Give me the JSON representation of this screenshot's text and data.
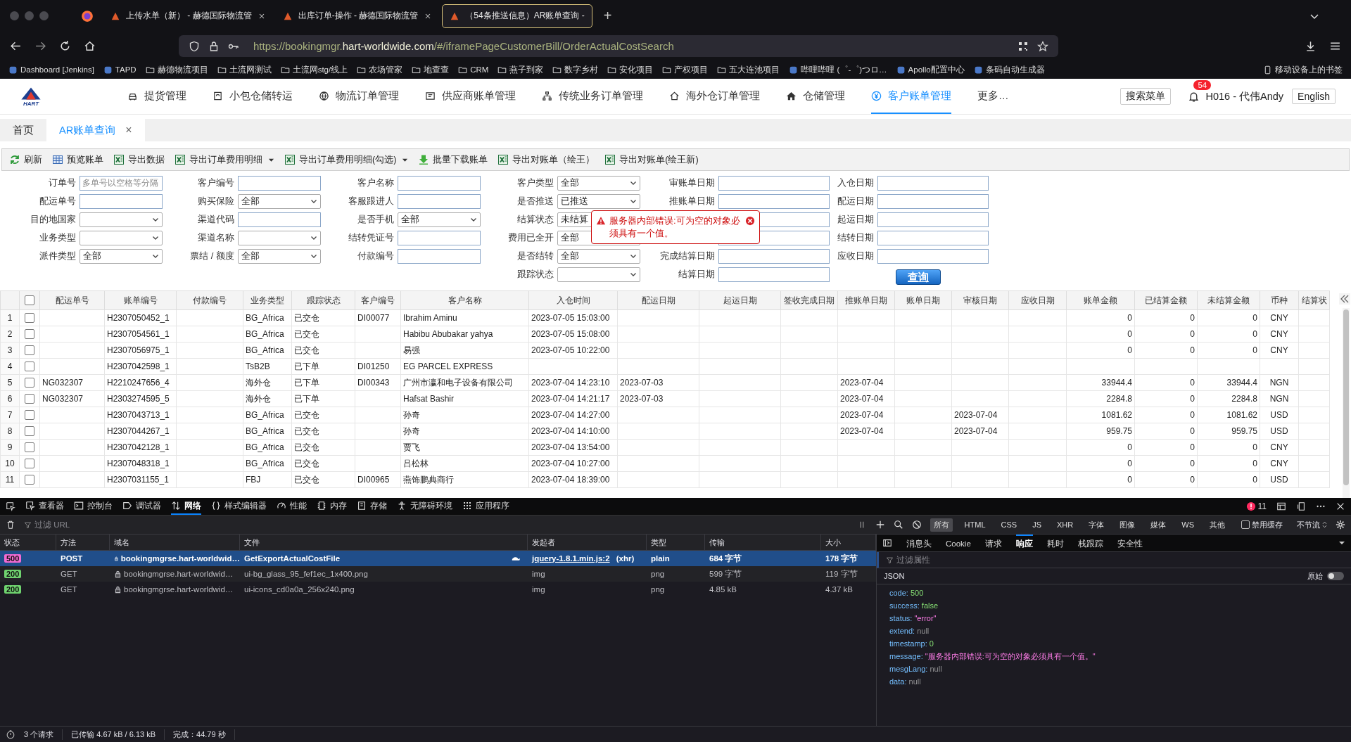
{
  "browser": {
    "tabs": [
      {
        "title": "上传水单（新） - 赫德国际物流管",
        "selected": false
      },
      {
        "title": "出库订单-操作 - 赫德国际物流管",
        "selected": false
      },
      {
        "title": "（54条推送信息）AR账单查询 - ",
        "selected": true
      }
    ],
    "new_tab": "+",
    "url": {
      "scheme": "https://bookingmgr.",
      "domain": "hart-worldwide.com",
      "path": "/#/iframePageCustomerBill/OrderActualCostSearch"
    },
    "bookmarks": [
      {
        "label": "Dashboard [Jenkins]",
        "kind": "site"
      },
      {
        "label": "TAPD",
        "kind": "site"
      },
      {
        "label": "赫德物流项目",
        "kind": "folder"
      },
      {
        "label": "土流网测试",
        "kind": "folder"
      },
      {
        "label": "土流网stg/线上",
        "kind": "folder"
      },
      {
        "label": "农场管家",
        "kind": "folder"
      },
      {
        "label": "地查查",
        "kind": "folder"
      },
      {
        "label": "CRM",
        "kind": "folder"
      },
      {
        "label": "燕子到家",
        "kind": "folder"
      },
      {
        "label": "数字乡村",
        "kind": "folder"
      },
      {
        "label": "安化项目",
        "kind": "folder"
      },
      {
        "label": "产权项目",
        "kind": "folder"
      },
      {
        "label": "五大连池项目",
        "kind": "folder"
      },
      {
        "label": "哔哩哔哩 (゜-゜)つロ…",
        "kind": "site"
      },
      {
        "label": "Apollo配置中心",
        "kind": "site"
      },
      {
        "label": "条码自动生成器",
        "kind": "site"
      }
    ],
    "mobile_bookmarks": "移动设备上的书签"
  },
  "app": {
    "logo": "HART",
    "nav": [
      {
        "label": "提货管理",
        "kind": "car",
        "selected": false
      },
      {
        "label": "小包仓储转运",
        "kind": "panel",
        "selected": false
      },
      {
        "label": "物流订单管理",
        "kind": "globe",
        "selected": false
      },
      {
        "label": "供应商账单管理",
        "kind": "receipt",
        "selected": false
      },
      {
        "label": "传统业务订单管理",
        "kind": "sitemap",
        "selected": false
      },
      {
        "label": "海外仓订单管理",
        "kind": "house",
        "selected": false
      },
      {
        "label": "仓储管理",
        "kind": "housefill",
        "selected": false
      },
      {
        "label": "客户账单管理",
        "kind": "yen",
        "selected": true
      },
      {
        "label": "更多…",
        "kind": "text",
        "selected": false
      }
    ],
    "search_menu": "搜索菜单",
    "notifications": "54",
    "user": "H016 - 代伟Andy",
    "language": "English"
  },
  "page_tabs": [
    {
      "label": "首页",
      "selected": false
    },
    {
      "label": "AR账单查询",
      "selected": true,
      "close": "×"
    }
  ],
  "toolbar": [
    {
      "label": "刷新",
      "kind": "refresh",
      "menu": false
    },
    {
      "label": "预览账单",
      "kind": "grid",
      "menu": false
    },
    {
      "label": "导出数据",
      "kind": "excel",
      "menu": false
    },
    {
      "label": "导出订单费用明细",
      "kind": "excel",
      "menu": true
    },
    {
      "label": "导出订单费用明细(勾选)",
      "kind": "excel",
      "menu": true
    },
    {
      "label": "批量下载账单",
      "kind": "download",
      "menu": false
    },
    {
      "label": "导出对账单（绘王）",
      "kind": "excel",
      "menu": false
    },
    {
      "label": "导出对账单(绘王新)",
      "kind": "excel",
      "menu": false
    }
  ],
  "form": {
    "columns": [
      [
        {
          "label": "订单号",
          "kind": "text",
          "placeholder": "多单号以空格等分隔"
        },
        {
          "label": "配运单号",
          "kind": "text"
        },
        {
          "label": "目的地国家",
          "kind": "select"
        },
        {
          "label": "业务类型",
          "kind": "select"
        },
        {
          "label": "派件类型",
          "kind": "select",
          "value": "全部"
        }
      ],
      [
        {
          "label": "客户编号",
          "kind": "text"
        },
        {
          "label": "购买保险",
          "kind": "select",
          "value": "全部"
        },
        {
          "label": "渠道代码",
          "kind": "text"
        },
        {
          "label": "渠道名称",
          "kind": "select"
        },
        {
          "label": "票结 / 额度",
          "kind": "select",
          "value": "全部"
        }
      ],
      [
        {
          "label": "客户名称",
          "kind": "text"
        },
        {
          "label": "客服跟进人",
          "kind": "text"
        },
        {
          "label": "是否手机",
          "kind": "select",
          "value": "全部"
        },
        {
          "label": "结转凭证号",
          "kind": "text"
        },
        {
          "label": "付款编号",
          "kind": "text"
        }
      ],
      [
        {
          "label": "客户类型",
          "kind": "select",
          "value": "全部"
        },
        {
          "label": "是否推送",
          "kind": "select",
          "value": "已推送"
        },
        {
          "label": "结算状态",
          "kind": "select",
          "value": "未结算"
        },
        {
          "label": "费用已全开",
          "kind": "select",
          "value": "全部"
        },
        {
          "label": "是否结转",
          "kind": "select",
          "value": "全部"
        },
        {
          "label": "跟踪状态",
          "kind": "select"
        }
      ],
      [
        {
          "label": "审账单日期",
          "kind": "date"
        },
        {
          "label": "推账单日期",
          "kind": "date"
        },
        {
          "kind": "date"
        },
        {
          "kind": "date"
        },
        {
          "label": "完成结算日期",
          "kind": "date"
        },
        {
          "label": "结算日期",
          "kind": "date"
        }
      ],
      [
        {
          "label": "入仓日期",
          "kind": "date"
        },
        {
          "label": "配运日期",
          "kind": "date"
        },
        {
          "label": "起运日期",
          "kind": "date"
        },
        {
          "label": "结转日期",
          "kind": "date"
        },
        {
          "label": "应收日期",
          "kind": "date"
        }
      ]
    ],
    "error": {
      "message": "服务器内部错误:可为空的对象必须具有一个值。"
    },
    "search_button": "查询"
  },
  "table": {
    "select_all": false,
    "columns": [
      {
        "label": "配运单号"
      },
      {
        "label": "账单编号"
      },
      {
        "label": "付款编号"
      },
      {
        "label": "业务类型"
      },
      {
        "label": "跟踪状态"
      },
      {
        "label": "客户编号"
      },
      {
        "label": "客户名称"
      },
      {
        "label": "入仓时间"
      },
      {
        "label": "配运日期"
      },
      {
        "label": "起运日期"
      },
      {
        "label": "签收完成日期"
      },
      {
        "label": "推账单日期"
      },
      {
        "label": "账单日期"
      },
      {
        "label": "审核日期"
      },
      {
        "label": "应收日期"
      },
      {
        "label": "账单金额",
        "kind": "amount"
      },
      {
        "label": "已结算金额",
        "kind": "amount"
      },
      {
        "label": "未结算金额",
        "kind": "amount"
      },
      {
        "label": "币种",
        "kind": "center"
      },
      {
        "label": "结算状"
      }
    ],
    "rows": [
      {
        "no": "1",
        "checked": false,
        "cells": [
          null,
          "H2307050452_1",
          null,
          "BG_Africa",
          "已交仓",
          "DI00077",
          "Ibrahim Aminu",
          "2023-07-05 15:03:00",
          null,
          null,
          null,
          null,
          null,
          null,
          null,
          "0",
          "0",
          "0",
          "CNY"
        ]
      },
      {
        "no": "2",
        "checked": false,
        "cells": [
          null,
          "H2307054561_1",
          null,
          "BG_Africa",
          "已交仓",
          null,
          "Habibu Abubakar yahya",
          "2023-07-05 15:08:00",
          null,
          null,
          null,
          null,
          null,
          null,
          null,
          "0",
          "0",
          "0",
          "CNY"
        ]
      },
      {
        "no": "3",
        "checked": false,
        "cells": [
          null,
          "H2307056975_1",
          null,
          "BG_Africa",
          "已交仓",
          null,
          "易强",
          "2023-07-05 10:22:00",
          null,
          null,
          null,
          null,
          null,
          null,
          null,
          "0",
          "0",
          "0",
          "CNY"
        ]
      },
      {
        "no": "4",
        "checked": false,
        "cells": [
          null,
          "H2307042598_1",
          null,
          "TsB2B",
          "已下单",
          "DI01250",
          "EG PARCEL EXPRESS",
          null,
          null,
          null,
          null,
          null,
          null,
          null,
          null,
          null,
          null,
          null,
          null
        ]
      },
      {
        "no": "5",
        "checked": false,
        "cells": [
          "NG032307",
          "H2210247656_4",
          null,
          "海外仓",
          "已下单",
          "DI00343",
          "广州市瀛和电子设备有限公司",
          "2023-07-04 14:23:10",
          "2023-07-03",
          null,
          null,
          "2023-07-04",
          null,
          null,
          null,
          "33944.4",
          "0",
          "33944.4",
          "NGN"
        ]
      },
      {
        "no": "6",
        "checked": false,
        "cells": [
          "NG032307",
          "H2303274595_5",
          null,
          "海外仓",
          "已下单",
          null,
          "Hafsat Bashir",
          "2023-07-04 14:21:17",
          "2023-07-03",
          null,
          null,
          "2023-07-04",
          null,
          null,
          null,
          "2284.8",
          "0",
          "2284.8",
          "NGN"
        ]
      },
      {
        "no": "7",
        "checked": false,
        "cells": [
          null,
          "H2307043713_1",
          null,
          "BG_Africa",
          "已交仓",
          null,
          "孙奇",
          "2023-07-04 14:27:00",
          null,
          null,
          null,
          "2023-07-04",
          null,
          "2023-07-04",
          null,
          "1081.62",
          "0",
          "1081.62",
          "USD"
        ]
      },
      {
        "no": "8",
        "checked": false,
        "cells": [
          null,
          "H2307044267_1",
          null,
          "BG_Africa",
          "已交仓",
          null,
          "孙奇",
          "2023-07-04 14:10:00",
          null,
          null,
          null,
          "2023-07-04",
          null,
          "2023-07-04",
          null,
          "959.75",
          "0",
          "959.75",
          "USD"
        ]
      },
      {
        "no": "9",
        "checked": false,
        "cells": [
          null,
          "H2307042128_1",
          null,
          "BG_Africa",
          "已交仓",
          null,
          "贾飞",
          "2023-07-04 13:54:00",
          null,
          null,
          null,
          null,
          null,
          null,
          null,
          "0",
          "0",
          "0",
          "CNY"
        ]
      },
      {
        "no": "10",
        "checked": false,
        "cells": [
          null,
          "H2307048318_1",
          null,
          "BG_Africa",
          "已交仓",
          null,
          "吕松林",
          "2023-07-04 10:27:00",
          null,
          null,
          null,
          null,
          null,
          null,
          null,
          "0",
          "0",
          "0",
          "CNY"
        ]
      },
      {
        "no": "11",
        "checked": false,
        "cells": [
          null,
          "H2307031155_1",
          null,
          "FBJ",
          "已交仓",
          "DI00965",
          "燕饰鹏典商行",
          "2023-07-04 18:39:00",
          null,
          null,
          null,
          null,
          null,
          null,
          null,
          "0",
          "0",
          "0",
          "USD"
        ]
      }
    ]
  },
  "devtools": {
    "tabs": [
      {
        "label": "查看器",
        "kind": "inspector",
        "selected": false
      },
      {
        "label": "控制台",
        "kind": "console",
        "selected": false
      },
      {
        "label": "调试器",
        "kind": "debugger",
        "selected": false
      },
      {
        "label": "网络",
        "kind": "network",
        "selected": true
      },
      {
        "label": "样式编辑器",
        "kind": "style",
        "selected": false
      },
      {
        "label": "性能",
        "kind": "gauge",
        "selected": false
      },
      {
        "label": "内存",
        "kind": "memory",
        "selected": false
      },
      {
        "label": "存储",
        "kind": "storage",
        "selected": false
      },
      {
        "label": "无障碍环境",
        "kind": "access",
        "selected": false
      },
      {
        "label": "应用程序",
        "kind": "apps",
        "selected": false
      }
    ],
    "error_count": "11",
    "filter_placeholder": "过滤 URL",
    "type_filters": [
      {
        "label": "所有",
        "selected": true
      },
      {
        "label": "HTML",
        "selected": false
      },
      {
        "label": "CSS",
        "selected": false
      },
      {
        "label": "JS",
        "selected": false
      },
      {
        "label": "XHR",
        "selected": false
      },
      {
        "label": "字体",
        "selected": false
      },
      {
        "label": "图像",
        "selected": false
      },
      {
        "label": "媒体",
        "selected": false
      },
      {
        "label": "WS",
        "selected": false
      },
      {
        "label": "其他",
        "selected": false
      }
    ],
    "disable_cache": {
      "label": "禁用缓存",
      "checked": false
    },
    "throttle": "不节流",
    "network": {
      "columns": [
        "状态",
        "方法",
        "域名",
        "文件",
        "发起者",
        "类型",
        "传输",
        "大小"
      ],
      "requests": [
        {
          "status": "500",
          "color": "#f26bd3",
          "method": "POST",
          "domain": "bookingmgrse.hart-worldwid…",
          "file": "GetExportActualCostFile",
          "slow": true,
          "initiator": "jquery-1.8.1.min.js:2",
          "initiator_note": "(xhr)",
          "type": "plain",
          "transferred": "684 字节",
          "size": "178 字节",
          "selected": true
        },
        {
          "status": "200",
          "color": "#6fd36f",
          "method": "GET",
          "domain": "bookingmgrse.hart-worldwid…",
          "file": "ui-bg_glass_95_fef1ec_1x400.png",
          "slow": false,
          "initiator": "img",
          "type": "png",
          "transferred": "599 字节",
          "size": "119 字节",
          "selected": false
        },
        {
          "status": "200",
          "color": "#6fd36f",
          "method": "GET",
          "domain": "bookingmgrse.hart-worldwid…",
          "file": "ui-icons_cd0a0a_256x240.png",
          "slow": false,
          "initiator": "img",
          "type": "png",
          "transferred": "4.85 kB",
          "size": "4.37 kB",
          "selected": false
        }
      ]
    },
    "summary": {
      "requests": "3 个请求",
      "transferred": "已传输 4.67 kB / 6.13 kB",
      "finished": "完成：44.79 秒"
    },
    "detail": {
      "tabs": [
        {
          "label": "消息头",
          "selected": false
        },
        {
          "label": "Cookie",
          "selected": false
        },
        {
          "label": "请求",
          "selected": false
        },
        {
          "label": "响应",
          "selected": true
        },
        {
          "label": "耗时",
          "selected": false
        },
        {
          "label": "栈跟踪",
          "selected": false
        },
        {
          "label": "安全性",
          "selected": false
        }
      ],
      "filter_placeholder": "过滤属性",
      "format": "JSON",
      "raw": {
        "label": "原始",
        "on": false
      },
      "lines": [
        {
          "key": "code:",
          "value": "500",
          "kind": "number"
        },
        {
          "key": "success:",
          "value": "false",
          "kind": "bool"
        },
        {
          "key": "status:",
          "value": "\"error\"",
          "kind": "string"
        },
        {
          "key": "extend:",
          "value": "null",
          "kind": "null"
        },
        {
          "key": "timestamp:",
          "value": "0",
          "kind": "number"
        },
        {
          "key": "message:",
          "value": "\"服务器内部错误:可为空的对象必须具有一个值。\"",
          "kind": "string"
        },
        {
          "key": "mesgLang:",
          "value": "null",
          "kind": "null"
        },
        {
          "key": "data:",
          "value": "null",
          "kind": "null"
        }
      ]
    }
  }
}
